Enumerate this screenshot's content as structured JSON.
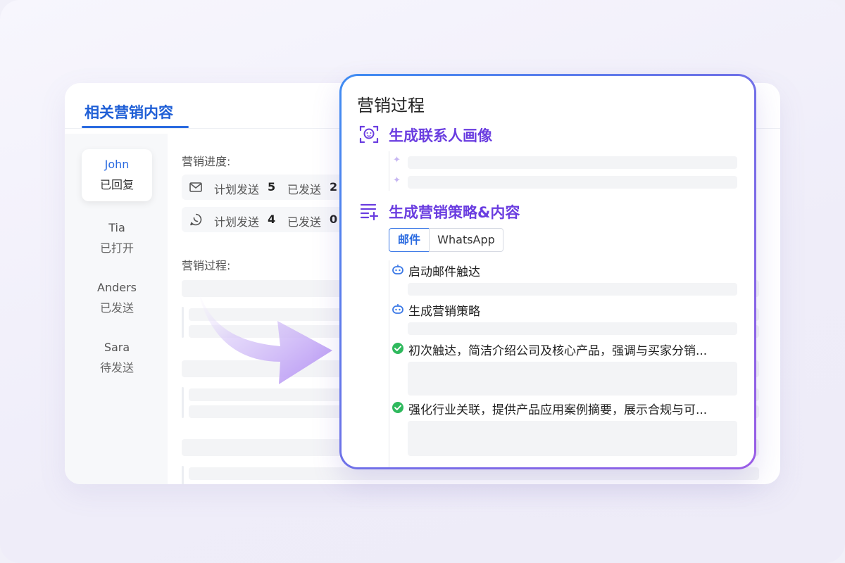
{
  "back": {
    "title": "相关营销内容",
    "contacts": [
      {
        "name": "John",
        "status": "已回复"
      },
      {
        "name": "Tia",
        "status": "已打开"
      },
      {
        "name": "Anders",
        "status": "已发送"
      },
      {
        "name": "Sara",
        "status": "待发送"
      }
    ],
    "progress_label": "营销进度:",
    "email_stats": {
      "planned_label": "计划发送",
      "planned": "5",
      "sent_label": "已发送",
      "sent": "2"
    },
    "whatsapp_stats": {
      "planned_label": "计划发送",
      "planned": "4",
      "sent_label": "已发送",
      "sent": "0"
    },
    "process_label": "营销过程:"
  },
  "front": {
    "title": "营销过程",
    "section1_title": "生成联系人画像",
    "section2_title": "生成营销策略&内容",
    "tabs": [
      "邮件",
      "WhatsApp"
    ],
    "steps": [
      {
        "text": "启动邮件触达",
        "status": "in-progress"
      },
      {
        "text": "生成营销策略",
        "status": "in-progress"
      },
      {
        "text": "初次触达，简洁介绍公司及核心产品，强调与买家分销...",
        "status": "done"
      },
      {
        "text": "强化行业关联，提供产品应用案例摘要，展示合规与可...",
        "status": "done"
      }
    ]
  },
  "colors": {
    "accent_blue": "#2b6be0",
    "accent_purple": "#6a3de0",
    "done_green": "#2fb95d"
  }
}
